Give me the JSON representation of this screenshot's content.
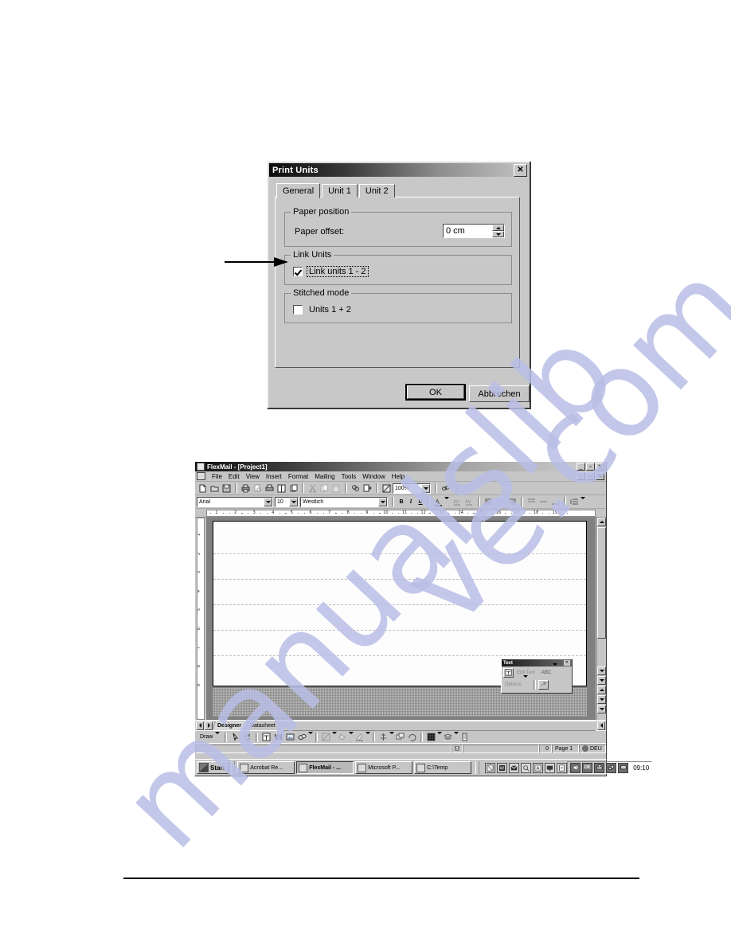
{
  "dialog": {
    "title": "Print Units",
    "close_label": "✕",
    "tabs": [
      {
        "label": "General",
        "active": true
      },
      {
        "label": "Unit 1",
        "active": false
      },
      {
        "label": "Unit 2",
        "active": false
      }
    ],
    "groups": {
      "paper_position": {
        "legend": "Paper position",
        "offset_label": "Paper offset:",
        "offset_value": "0 cm"
      },
      "link_units": {
        "legend": "Link Units",
        "checkbox_label": "Link units 1 - 2",
        "checked": true
      },
      "stitched_mode": {
        "legend": "Stitched mode",
        "checkbox_label": "Units 1 + 2",
        "checked": false
      }
    },
    "buttons": {
      "ok": "OK",
      "cancel": "Abbrechen"
    }
  },
  "flexmail": {
    "title": "FlexMail - [Project1]",
    "window_buttons": {
      "minimize": "_",
      "restore": "▫",
      "close": "✕"
    },
    "menu": [
      "File",
      "Edit",
      "View",
      "Insert",
      "Format",
      "Mailing",
      "Tools",
      "Window",
      "Help"
    ],
    "standard_toolbar": {
      "zoom_value": "100%"
    },
    "formatting_toolbar": {
      "font_name": "Arial",
      "font_size": "10",
      "script": "Westlich",
      "bold": "B",
      "italic": "I",
      "underline": "U"
    },
    "ruler_h_numbers": [
      "1",
      "2",
      "3",
      "4",
      "5",
      "6",
      "7",
      "8",
      "9",
      "10",
      "11",
      "12",
      "13",
      "14",
      "15",
      "16",
      "17",
      "18",
      "19"
    ],
    "ruler_v_numbers": [
      "1",
      "2",
      "3",
      "4",
      "5",
      "6",
      "7",
      "8",
      "9"
    ],
    "sheet_tabs": [
      {
        "label": "Designer",
        "active": true
      },
      {
        "label": "Datasheet",
        "active": false
      }
    ],
    "draw_menu": "Draw",
    "status_bar": {
      "page": "Page 1",
      "language": "DEU",
      "value": "0"
    }
  },
  "text_palette": {
    "title": "Text",
    "close_label": "✕",
    "edit_text": "Edit Text",
    "abc": "ABC",
    "options": "Options"
  },
  "taskbar": {
    "start": "Start",
    "tasks": [
      {
        "label": "Acrobat Re...",
        "active": false
      },
      {
        "label": "FlexMail - ...",
        "active": true
      },
      {
        "label": "Microsoft P...",
        "active": false
      },
      {
        "label": "C:\\Temp",
        "active": false
      }
    ],
    "tray": {
      "language": "DE",
      "clock": "09:10"
    }
  },
  "watermark": {
    "line1": "manualslib",
    "line2": "ve.com"
  }
}
